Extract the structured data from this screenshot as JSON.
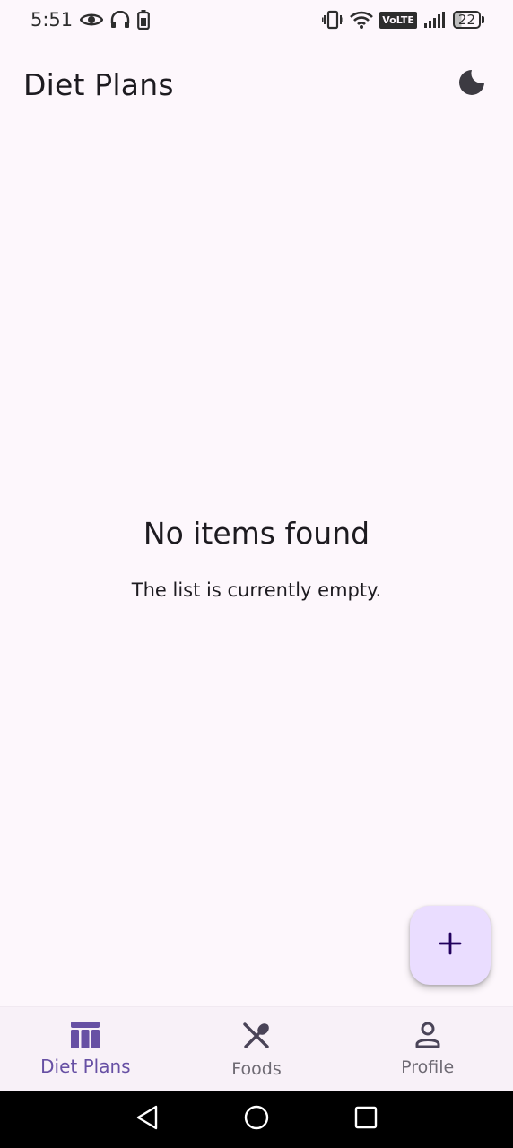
{
  "status_bar": {
    "time": "5:51",
    "battery_level": "22",
    "icons_left": [
      "eye-icon",
      "headphones-icon",
      "battery-saver-icon"
    ],
    "icons_right": [
      "vibrate-icon",
      "wifi-icon",
      "volte-icon",
      "signal-icon",
      "battery-icon"
    ],
    "volte_label": "VoLTE"
  },
  "app_bar": {
    "title": "Diet Plans",
    "theme_toggle_icon": "moon-icon"
  },
  "empty_state": {
    "title": "No items found",
    "subtitle": "The list is currently empty."
  },
  "fab": {
    "icon": "plus-icon"
  },
  "bottom_nav": {
    "items": [
      {
        "label": "Diet Plans",
        "icon": "table-icon",
        "active": true
      },
      {
        "label": "Foods",
        "icon": "utensils-icon",
        "active": false
      },
      {
        "label": "Profile",
        "icon": "person-icon",
        "active": false
      }
    ]
  },
  "system_nav": {
    "icons": [
      "back-icon",
      "home-icon",
      "recents-icon"
    ]
  },
  "colors": {
    "background": "#fdf7fc",
    "accent": "#6750a4",
    "fab_background": "#eaddff",
    "nav_background": "#f8f1f8"
  }
}
